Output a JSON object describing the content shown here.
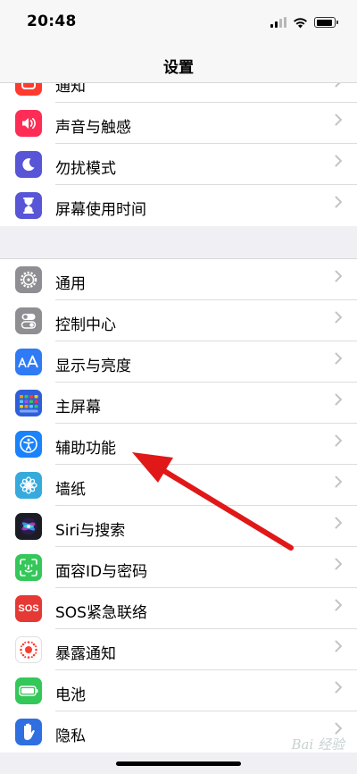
{
  "status": {
    "time": "20:48"
  },
  "nav": {
    "title": "设置"
  },
  "group_top": [
    {
      "key": "notifications",
      "label": "通知",
      "color": "#ff3b30"
    },
    {
      "key": "sounds",
      "label": "声音与触感",
      "color": "#ff2d55"
    },
    {
      "key": "dnd",
      "label": "勿扰模式",
      "color": "#5856d6"
    },
    {
      "key": "screentime",
      "label": "屏幕使用时间",
      "color": "#5856d6"
    }
  ],
  "group_main": [
    {
      "key": "general",
      "label": "通用",
      "color": "#8e8e93"
    },
    {
      "key": "control-center",
      "label": "控制中心",
      "color": "#8e8e93"
    },
    {
      "key": "display",
      "label": "显示与亮度",
      "color": "#2f7bf5"
    },
    {
      "key": "home-screen",
      "label": "主屏幕",
      "color": "#2f5fd8"
    },
    {
      "key": "accessibility",
      "label": "辅助功能",
      "color": "#1a82fb"
    },
    {
      "key": "wallpaper",
      "label": "墙纸",
      "color": "#36aadc"
    },
    {
      "key": "siri",
      "label": "Siri与搜索",
      "color": "#222"
    },
    {
      "key": "faceid",
      "label": "面容ID与密码",
      "color": "#34c759"
    },
    {
      "key": "sos",
      "label": "SOS紧急联络",
      "color": "#e53935",
      "icon_text": "SOS"
    },
    {
      "key": "exposure",
      "label": "暴露通知",
      "color": "#fff"
    },
    {
      "key": "battery",
      "label": "电池",
      "color": "#34c759"
    },
    {
      "key": "privacy",
      "label": "隐私",
      "color": "#2f6fe0"
    }
  ],
  "watermark": "Bai 经验",
  "annotation_color": "#e01818"
}
